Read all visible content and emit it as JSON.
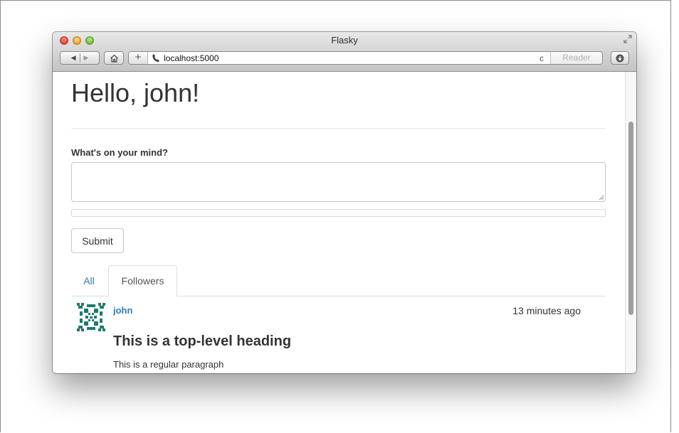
{
  "browser": {
    "window_title": "Flasky",
    "url": "localhost:5000",
    "reader_label": "Reader",
    "back_glyph": "◀",
    "forward_glyph": "▶",
    "new_tab_glyph": "+",
    "reload_glyph": "c"
  },
  "page": {
    "greeting": "Hello, john!",
    "form": {
      "label": "What's on your mind?",
      "body_value": "",
      "submit_label": "Submit"
    },
    "tabs": [
      {
        "label": "All",
        "active": false
      },
      {
        "label": "Followers",
        "active": true
      }
    ],
    "post": {
      "author": "john",
      "timestamp": "13 minutes ago",
      "heading": "This is a top-level heading",
      "paragraph": "This is a regular paragraph"
    }
  },
  "icons": {
    "traffic_lights": [
      "close-icon",
      "minimize-icon",
      "zoom-icon"
    ],
    "toolbar": [
      "back-icon",
      "forward-icon",
      "home-icon",
      "new-tab-icon",
      "phone-icon",
      "reload-icon",
      "downloads-icon",
      "fullscreen-icon"
    ],
    "avatar": "identicon-avatar"
  },
  "colors": {
    "link": "#337ab7",
    "text": "#333333",
    "avatar_fill": "#1e7a6e"
  }
}
